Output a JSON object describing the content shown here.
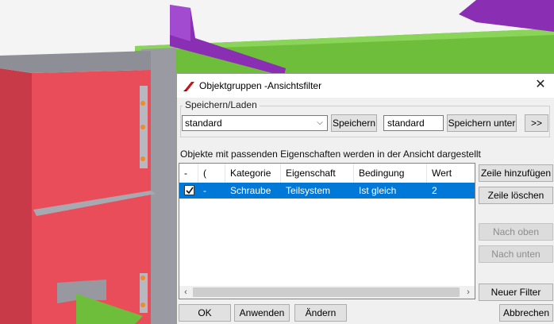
{
  "dialog": {
    "title": "Objektgruppen -Ansichtsfilter",
    "close_label": "✕",
    "save_load": {
      "group_label": "Speichern/Laden",
      "preset_value": "standard",
      "save_button": "Speichern",
      "name_value": "standard",
      "save_as_button": "Speichern unter",
      "more_button": ">>"
    },
    "info_text": "Objekte mit passenden Eigenschaften werden in der Ansicht dargestellt",
    "table": {
      "columns": [
        "-",
        "(",
        "Kategorie",
        "Eigenschaft",
        "Bedingung",
        "Wert"
      ],
      "rows": [
        {
          "checked": true,
          "dash": "-",
          "kategorie": "Schraube",
          "eigenschaft": "Teilsystem",
          "bedingung": "Ist gleich",
          "wert": "2"
        }
      ]
    },
    "side_buttons": {
      "add_row": "Zeile hinzufügen",
      "delete_row": "Zeile löschen",
      "move_up": "Nach oben",
      "move_down": "Nach unten",
      "new_filter": "Neuer Filter"
    },
    "footer": {
      "ok": "OK",
      "apply": "Anwenden",
      "modify": "Ändern",
      "cancel": "Abbrechen"
    }
  },
  "colors": {
    "selection": "#0078d7",
    "plate_red": "#ea4d5a",
    "beam_purple": "#8a2fb4",
    "beam_green": "#6fbf3a"
  }
}
